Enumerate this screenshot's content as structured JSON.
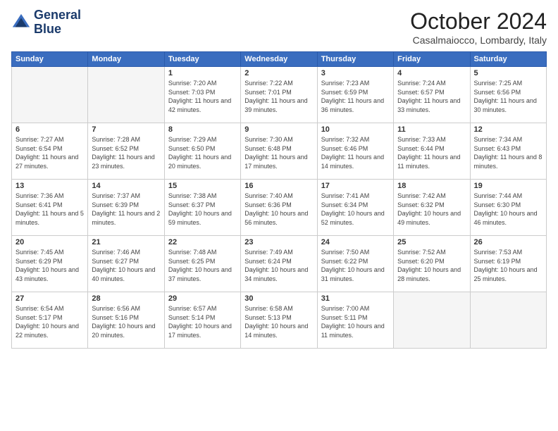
{
  "header": {
    "logo_line1": "General",
    "logo_line2": "Blue",
    "month": "October 2024",
    "location": "Casalmaiocco, Lombardy, Italy"
  },
  "weekdays": [
    "Sunday",
    "Monday",
    "Tuesday",
    "Wednesday",
    "Thursday",
    "Friday",
    "Saturday"
  ],
  "weeks": [
    [
      {
        "day": "",
        "info": "",
        "empty": true
      },
      {
        "day": "",
        "info": "",
        "empty": true
      },
      {
        "day": "1",
        "info": "Sunrise: 7:20 AM\nSunset: 7:03 PM\nDaylight: 11 hours and 42 minutes."
      },
      {
        "day": "2",
        "info": "Sunrise: 7:22 AM\nSunset: 7:01 PM\nDaylight: 11 hours and 39 minutes."
      },
      {
        "day": "3",
        "info": "Sunrise: 7:23 AM\nSunset: 6:59 PM\nDaylight: 11 hours and 36 minutes."
      },
      {
        "day": "4",
        "info": "Sunrise: 7:24 AM\nSunset: 6:57 PM\nDaylight: 11 hours and 33 minutes."
      },
      {
        "day": "5",
        "info": "Sunrise: 7:25 AM\nSunset: 6:56 PM\nDaylight: 11 hours and 30 minutes."
      }
    ],
    [
      {
        "day": "6",
        "info": "Sunrise: 7:27 AM\nSunset: 6:54 PM\nDaylight: 11 hours and 27 minutes."
      },
      {
        "day": "7",
        "info": "Sunrise: 7:28 AM\nSunset: 6:52 PM\nDaylight: 11 hours and 23 minutes."
      },
      {
        "day": "8",
        "info": "Sunrise: 7:29 AM\nSunset: 6:50 PM\nDaylight: 11 hours and 20 minutes."
      },
      {
        "day": "9",
        "info": "Sunrise: 7:30 AM\nSunset: 6:48 PM\nDaylight: 11 hours and 17 minutes."
      },
      {
        "day": "10",
        "info": "Sunrise: 7:32 AM\nSunset: 6:46 PM\nDaylight: 11 hours and 14 minutes."
      },
      {
        "day": "11",
        "info": "Sunrise: 7:33 AM\nSunset: 6:44 PM\nDaylight: 11 hours and 11 minutes."
      },
      {
        "day": "12",
        "info": "Sunrise: 7:34 AM\nSunset: 6:43 PM\nDaylight: 11 hours and 8 minutes."
      }
    ],
    [
      {
        "day": "13",
        "info": "Sunrise: 7:36 AM\nSunset: 6:41 PM\nDaylight: 11 hours and 5 minutes."
      },
      {
        "day": "14",
        "info": "Sunrise: 7:37 AM\nSunset: 6:39 PM\nDaylight: 11 hours and 2 minutes."
      },
      {
        "day": "15",
        "info": "Sunrise: 7:38 AM\nSunset: 6:37 PM\nDaylight: 10 hours and 59 minutes."
      },
      {
        "day": "16",
        "info": "Sunrise: 7:40 AM\nSunset: 6:36 PM\nDaylight: 10 hours and 56 minutes."
      },
      {
        "day": "17",
        "info": "Sunrise: 7:41 AM\nSunset: 6:34 PM\nDaylight: 10 hours and 52 minutes."
      },
      {
        "day": "18",
        "info": "Sunrise: 7:42 AM\nSunset: 6:32 PM\nDaylight: 10 hours and 49 minutes."
      },
      {
        "day": "19",
        "info": "Sunrise: 7:44 AM\nSunset: 6:30 PM\nDaylight: 10 hours and 46 minutes."
      }
    ],
    [
      {
        "day": "20",
        "info": "Sunrise: 7:45 AM\nSunset: 6:29 PM\nDaylight: 10 hours and 43 minutes."
      },
      {
        "day": "21",
        "info": "Sunrise: 7:46 AM\nSunset: 6:27 PM\nDaylight: 10 hours and 40 minutes."
      },
      {
        "day": "22",
        "info": "Sunrise: 7:48 AM\nSunset: 6:25 PM\nDaylight: 10 hours and 37 minutes."
      },
      {
        "day": "23",
        "info": "Sunrise: 7:49 AM\nSunset: 6:24 PM\nDaylight: 10 hours and 34 minutes."
      },
      {
        "day": "24",
        "info": "Sunrise: 7:50 AM\nSunset: 6:22 PM\nDaylight: 10 hours and 31 minutes."
      },
      {
        "day": "25",
        "info": "Sunrise: 7:52 AM\nSunset: 6:20 PM\nDaylight: 10 hours and 28 minutes."
      },
      {
        "day": "26",
        "info": "Sunrise: 7:53 AM\nSunset: 6:19 PM\nDaylight: 10 hours and 25 minutes."
      }
    ],
    [
      {
        "day": "27",
        "info": "Sunrise: 6:54 AM\nSunset: 5:17 PM\nDaylight: 10 hours and 22 minutes."
      },
      {
        "day": "28",
        "info": "Sunrise: 6:56 AM\nSunset: 5:16 PM\nDaylight: 10 hours and 20 minutes."
      },
      {
        "day": "29",
        "info": "Sunrise: 6:57 AM\nSunset: 5:14 PM\nDaylight: 10 hours and 17 minutes."
      },
      {
        "day": "30",
        "info": "Sunrise: 6:58 AM\nSunset: 5:13 PM\nDaylight: 10 hours and 14 minutes."
      },
      {
        "day": "31",
        "info": "Sunrise: 7:00 AM\nSunset: 5:11 PM\nDaylight: 10 hours and 11 minutes."
      },
      {
        "day": "",
        "info": "",
        "empty": true
      },
      {
        "day": "",
        "info": "",
        "empty": true
      }
    ]
  ]
}
